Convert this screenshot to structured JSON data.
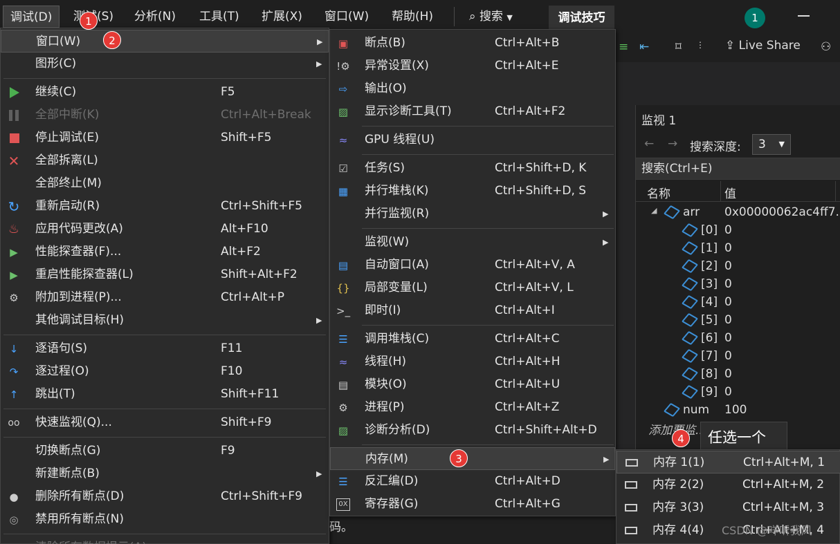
{
  "menubar": {
    "items": [
      "调试(D)",
      "测试(S)",
      "分析(N)",
      "工具(T)",
      "扩展(X)",
      "窗口(W)",
      "帮助(H)"
    ],
    "search_label": "搜索",
    "debug_tips": "调试技巧",
    "avatar_count": "1"
  },
  "toolbar": {
    "live_share": "Live Share"
  },
  "debug_menu": {
    "items": [
      {
        "label": "窗口(W)",
        "shortcut": ""
      },
      {
        "label": "图形(C)",
        "shortcut": ""
      },
      {
        "label": "继续(C)",
        "shortcut": "F5"
      },
      {
        "label": "全部中断(K)",
        "shortcut": "Ctrl+Alt+Break"
      },
      {
        "label": "停止调试(E)",
        "shortcut": "Shift+F5"
      },
      {
        "label": "全部拆离(L)",
        "shortcut": ""
      },
      {
        "label": "全部终止(M)",
        "shortcut": ""
      },
      {
        "label": "重新启动(R)",
        "shortcut": "Ctrl+Shift+F5"
      },
      {
        "label": "应用代码更改(A)",
        "shortcut": "Alt+F10"
      },
      {
        "label": "性能探查器(F)...",
        "shortcut": "Alt+F2"
      },
      {
        "label": "重启性能探查器(L)",
        "shortcut": "Shift+Alt+F2"
      },
      {
        "label": "附加到进程(P)...",
        "shortcut": "Ctrl+Alt+P"
      },
      {
        "label": "其他调试目标(H)",
        "shortcut": ""
      },
      {
        "label": "逐语句(S)",
        "shortcut": "F11"
      },
      {
        "label": "逐过程(O)",
        "shortcut": "F10"
      },
      {
        "label": "跳出(T)",
        "shortcut": "Shift+F11"
      },
      {
        "label": "快速监视(Q)...",
        "shortcut": "Shift+F9"
      },
      {
        "label": "切换断点(G)",
        "shortcut": "F9"
      },
      {
        "label": "新建断点(B)",
        "shortcut": ""
      },
      {
        "label": "删除所有断点(D)",
        "shortcut": "Ctrl+Shift+F9"
      },
      {
        "label": "禁用所有断点(N)",
        "shortcut": ""
      },
      {
        "label": "清除所有数据提示(A)",
        "shortcut": ""
      }
    ]
  },
  "window_menu": {
    "items": [
      {
        "label": "断点(B)",
        "shortcut": "Ctrl+Alt+B"
      },
      {
        "label": "异常设置(X)",
        "shortcut": "Ctrl+Alt+E"
      },
      {
        "label": "输出(O)",
        "shortcut": ""
      },
      {
        "label": "显示诊断工具(T)",
        "shortcut": "Ctrl+Alt+F2"
      },
      {
        "label": "GPU 线程(U)",
        "shortcut": ""
      },
      {
        "label": "任务(S)",
        "shortcut": "Ctrl+Shift+D, K"
      },
      {
        "label": "并行堆栈(K)",
        "shortcut": "Ctrl+Shift+D, S"
      },
      {
        "label": "并行监视(R)",
        "shortcut": ""
      },
      {
        "label": "监视(W)",
        "shortcut": ""
      },
      {
        "label": "自动窗口(A)",
        "shortcut": "Ctrl+Alt+V, A"
      },
      {
        "label": "局部变量(L)",
        "shortcut": "Ctrl+Alt+V, L"
      },
      {
        "label": "即时(I)",
        "shortcut": "Ctrl+Alt+I"
      },
      {
        "label": "调用堆栈(C)",
        "shortcut": "Ctrl+Alt+C"
      },
      {
        "label": "线程(H)",
        "shortcut": "Ctrl+Alt+H"
      },
      {
        "label": "模块(O)",
        "shortcut": "Ctrl+Alt+U"
      },
      {
        "label": "进程(P)",
        "shortcut": "Ctrl+Alt+Z"
      },
      {
        "label": "诊断分析(D)",
        "shortcut": "Ctrl+Shift+Alt+D"
      },
      {
        "label": "内存(M)",
        "shortcut": ""
      },
      {
        "label": "反汇编(D)",
        "shortcut": "Ctrl+Alt+D"
      },
      {
        "label": "寄存器(G)",
        "shortcut": "Ctrl+Alt+G"
      }
    ]
  },
  "memory_menu": {
    "items": [
      {
        "label": "内存 1(1)",
        "shortcut": "Ctrl+Alt+M, 1"
      },
      {
        "label": "内存 2(2)",
        "shortcut": "Ctrl+Alt+M, 2"
      },
      {
        "label": "内存 3(3)",
        "shortcut": "Ctrl+Alt+M, 3"
      },
      {
        "label": "内存 4(4)",
        "shortcut": "Ctrl+Alt+M, 4"
      }
    ]
  },
  "watch": {
    "title": "监视 1",
    "depth_label": "搜索深度:",
    "depth_value": "3",
    "search_placeholder": "搜索(Ctrl+E)",
    "col_name": "名称",
    "col_value": "值",
    "rows": [
      {
        "name": "arr",
        "value": "0x00000062ac4ff7..."
      },
      {
        "name": "[0]",
        "value": "0"
      },
      {
        "name": "[1]",
        "value": "0"
      },
      {
        "name": "[2]",
        "value": "0"
      },
      {
        "name": "[3]",
        "value": "0"
      },
      {
        "name": "[4]",
        "value": "0"
      },
      {
        "name": "[5]",
        "value": "0"
      },
      {
        "name": "[6]",
        "value": "0"
      },
      {
        "name": "[7]",
        "value": "0"
      },
      {
        "name": "[8]",
        "value": "0"
      },
      {
        "name": "[9]",
        "value": "0"
      },
      {
        "name": "num",
        "value": "100"
      }
    ],
    "add_item": "添加要监..."
  },
  "annotations": {
    "badge1": "1",
    "badge2": "2",
    "badge3": "3",
    "badge4": "4",
    "tooltip": "任选一个"
  },
  "editor_fragment": "码。",
  "watermark": "CSDN @咩听我风",
  "colors": {
    "accent_green": "#4caf50",
    "stop_red": "#e05555",
    "badge_red": "#e53935",
    "avatar_teal": "#00796b"
  }
}
